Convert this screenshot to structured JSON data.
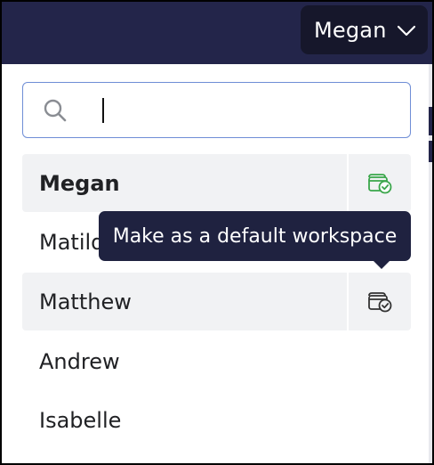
{
  "header": {
    "user_name": "Megan",
    "chevron_icon": "chevron-down-icon"
  },
  "search": {
    "placeholder": "",
    "value": "",
    "icon": "search-icon"
  },
  "workspaces": [
    {
      "name": "Megan",
      "is_default": true,
      "highlighted": true,
      "bold": true,
      "icon_color": "#3aa64a"
    },
    {
      "name": "Matilda",
      "is_default": false,
      "highlighted": false,
      "bold": false
    },
    {
      "name": "Matthew",
      "is_default": false,
      "highlighted": true,
      "bold": false,
      "icon_color": "#333333"
    },
    {
      "name": "Andrew",
      "is_default": false,
      "highlighted": false,
      "bold": false
    },
    {
      "name": "Isabelle",
      "is_default": false,
      "highlighted": false,
      "bold": false
    }
  ],
  "tooltip": {
    "text": "Make as a default workspace"
  },
  "colors": {
    "topbar": "#23254a",
    "user_button": "#16172b",
    "tooltip_bg": "#1f2240",
    "search_border": "#6f8ed6",
    "row_highlight": "#f1f2f4",
    "default_icon": "#3aa64a"
  }
}
